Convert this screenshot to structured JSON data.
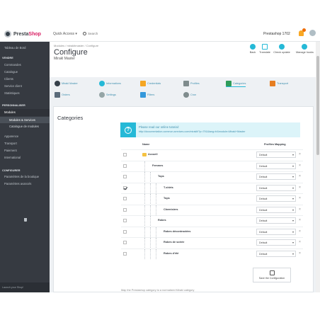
{
  "topbar": {
    "logo_brand": "Presta",
    "logo_brand2": "Shop",
    "quick_access": "Quick Access ▾",
    "search_placeholder": "Search",
    "shop_name": "Prestashop 1702"
  },
  "sidebar": {
    "dashboard": "Tableau de Bord",
    "section_sell": "VENDRE",
    "items_sell": [
      "Commandes",
      "Catalogue",
      "Clients",
      "Service client",
      "Statistiques"
    ],
    "section_custom": "PERSONNALISER",
    "modules": "Modules",
    "modules_sub": [
      "Modules & Services",
      "Catalogue de modules"
    ],
    "items_custom": [
      "Apparence",
      "Transport",
      "Paiement",
      "International"
    ],
    "section_config": "CONFIGURER",
    "items_config": [
      "Paramètres de la boutique",
      "Paramètres avancés"
    ],
    "footer": "Launch your Shop!"
  },
  "header": {
    "breadcrumb": "Modules  /  mirakltmaster  /  Configure",
    "title": "Configure",
    "subtitle": "Mirakl Master",
    "toolbar": [
      "Back",
      "Translate",
      "Check update",
      "Manage hooks"
    ]
  },
  "tabs": {
    "row1": [
      "Mirakl Master",
      "Informations",
      "Credentials",
      "Profiles",
      "Categories",
      "Transport"
    ],
    "row2": [
      "Orders",
      "Settings",
      "Filters",
      "Cron"
    ],
    "active": "Categories"
  },
  "panel": {
    "title": "Categories",
    "alert_line1": "Please read our online tutorial:",
    "alert_line2": "http://documentation.common-services.com/miraklf/?p=791&lang=fr&module=Mirakl+Master",
    "col_name": "Name",
    "col_mapping": "Profiles Mapping",
    "rows": [
      {
        "name": "Accueil",
        "depth": 0,
        "checked": false,
        "bold": true,
        "value": "Default"
      },
      {
        "name": "Femmes",
        "depth": 1,
        "checked": false,
        "bold": true,
        "value": "Default"
      },
      {
        "name": "Tops",
        "depth": 2,
        "checked": false,
        "bold": true,
        "value": "Default"
      },
      {
        "name": "T-shirts",
        "depth": 3,
        "checked": true,
        "bold": true,
        "value": "Default"
      },
      {
        "name": "Tops",
        "depth": 3,
        "checked": false,
        "bold": true,
        "value": "Default"
      },
      {
        "name": "Chemisiers",
        "depth": 3,
        "checked": false,
        "bold": true,
        "value": "Default"
      },
      {
        "name": "Robes",
        "depth": 2,
        "checked": false,
        "bold": true,
        "value": "Default"
      },
      {
        "name": "Robes décontractées",
        "depth": 3,
        "checked": false,
        "bold": true,
        "value": "Default"
      },
      {
        "name": "Robes de soirée",
        "depth": 3,
        "checked": false,
        "bold": true,
        "value": "Default"
      },
      {
        "name": "Robes d'été",
        "depth": 3,
        "checked": false,
        "bold": true,
        "value": "Default"
      }
    ],
    "mapping_note": "Map the Prestashop category to a normalized Mirakl category",
    "save_label": "Save the Configuration"
  },
  "colors": {
    "accent": "#25b9d7",
    "sidebar": "#363a41",
    "brand": "#d81b60"
  }
}
